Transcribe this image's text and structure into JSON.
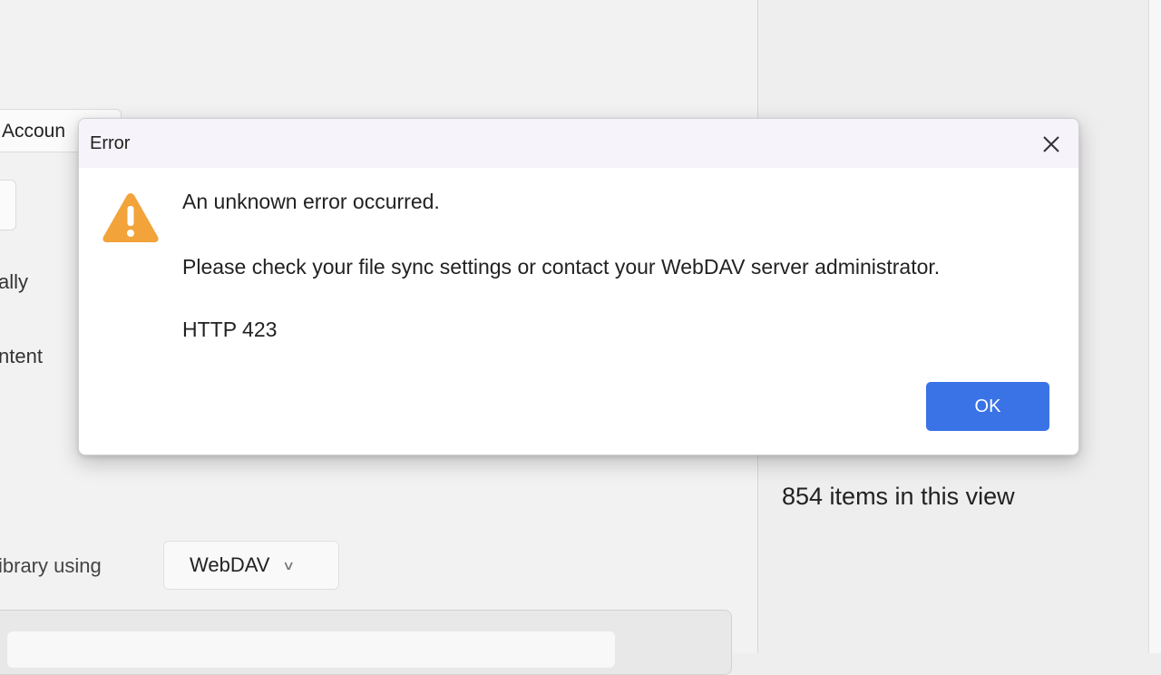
{
  "background": {
    "account_button_label": "Accoun",
    "setting_text_1": "ally",
    "setting_text_2": "ntent",
    "sync_label": "ibrary using",
    "sync_protocol_value": "WebDAV",
    "items_count_text": "854 items in this view"
  },
  "dialog": {
    "title": "Error",
    "message_main": "An unknown error occurred.",
    "message_detail": "Please check your file sync settings or contact your WebDAV server administrator.",
    "message_code": "HTTP 423",
    "ok_label": "OK",
    "icon": "warning-icon",
    "accent_color": "#3a73e6",
    "warning_color": "#f2a33a"
  }
}
